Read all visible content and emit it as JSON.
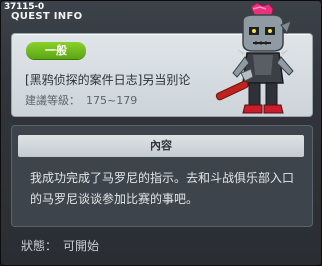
{
  "window": {
    "quest_id": "37115-0",
    "title": "QUEST INFO"
  },
  "quest": {
    "category_badge": "一般",
    "name": "[黑鸦侦探的案件日志]另当别论",
    "level_label": "建議等級：",
    "level_range": "175~179"
  },
  "content": {
    "header": "內容",
    "line1": "我成功完成了马罗尼的指示。去和斗战俱乐部入口",
    "line2": "的马罗尼谈谈参加比赛的事吧。"
  },
  "status": {
    "label": "狀態：",
    "value": "可開始"
  },
  "colors": {
    "badge": "#6cbd1c",
    "panel_light": "#d8dee2",
    "panel_dark": "#3d444b"
  },
  "icons": {
    "character": "zombie-punk-with-wrench"
  }
}
